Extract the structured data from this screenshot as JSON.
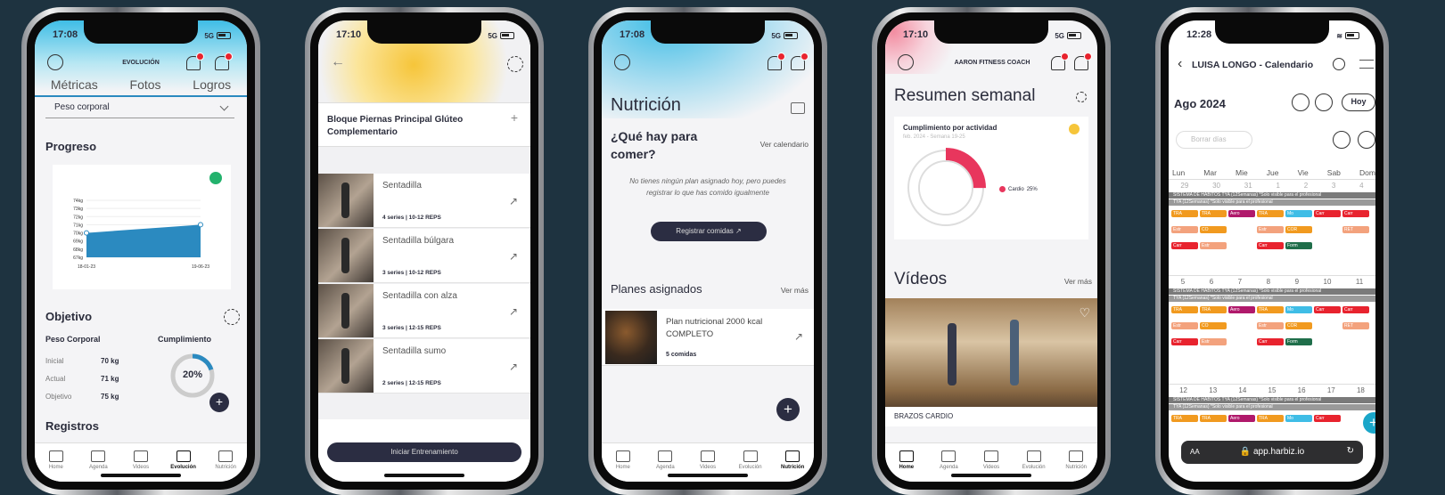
{
  "colors": {
    "bg": "#1e3340",
    "navy": "#2b2d42",
    "accent_pink": "#e8365d",
    "green": "#23b26d",
    "blue": "#2b8ac0"
  },
  "tabbar": [
    "Home",
    "Agenda",
    "Videos",
    "Evolución",
    "Nutrición"
  ],
  "p1": {
    "time": "17:08",
    "net": "5G",
    "title": "EVOLUCIÓN",
    "tabs": [
      "Métricas",
      "Fotos",
      "Logros"
    ],
    "select": "Peso corporal",
    "progress_title": "Progreso",
    "chart_data": {
      "type": "area",
      "x": [
        "18-01-23",
        "19-06-23"
      ],
      "y": [
        70,
        71
      ],
      "ylabels": [
        "74kg",
        "73kg",
        "72kg",
        "71kg",
        "70kg",
        "69kg",
        "68kg",
        "67kg"
      ],
      "ylim": [
        67,
        74
      ]
    },
    "goal_title": "Objetivo",
    "goal_label": "Peso Corporal",
    "compliance": "Cumplimiento",
    "rows": [
      {
        "k": "Inicial",
        "v": "70 kg"
      },
      {
        "k": "Actual",
        "v": "71 kg"
      },
      {
        "k": "Objetivo",
        "v": "75 kg"
      }
    ],
    "percent": "20%",
    "percent_value": 20,
    "records": "Registros"
  },
  "p2": {
    "time": "17:10",
    "net": "5G",
    "block": "Bloque Piernas Principal Glúteo Complementario",
    "exercises": [
      {
        "name": "Sentadilla",
        "meta": "4 series | 10-12 REPS"
      },
      {
        "name": "Sentadilla búlgara",
        "meta": "3 series | 10-12 REPS"
      },
      {
        "name": "Sentadilla con alza",
        "meta": "3 series | 12-15 REPS"
      },
      {
        "name": "Sentadilla sumo",
        "meta": "2 series | 12-15 REPS"
      }
    ],
    "start": "Iniciar Entrenamiento"
  },
  "p3": {
    "time": "17:08",
    "net": "5G",
    "title": "Nutrición",
    "q": "¿Qué hay para comer?",
    "cal": "Ver calendario",
    "empty": "No tienes ningún plan asignado hoy, pero puedes registrar lo que has comido igualmente",
    "register": "Registrar comidas",
    "plans": "Planes asignados",
    "more": "Ver más",
    "plan_name": "Plan nutricional 2000 kcal COMPLETO",
    "plan_meta": "5 comidas"
  },
  "p4": {
    "time": "17:10",
    "net": "5G",
    "coach": "AARON FITNESS COACH",
    "title": "Resumen semanal",
    "card_title": "Cumplimiento por actividad",
    "card_sub": "feb. 2024 - Semana 19-25",
    "legend": "Cardio",
    "legend_val": "25%",
    "donut_value": 25,
    "videos": "Vídeos",
    "more": "Ver más",
    "video_title": "BRAZOS CARDIO"
  },
  "p5": {
    "time": "12:28",
    "title": "LUISA LONGO - Calendario",
    "month": "Ago 2024",
    "today": "Hoy",
    "delete": "Borrar días",
    "days": [
      "Lun",
      "Mar",
      "Mie",
      "Jue",
      "Vie",
      "Sab",
      "Dom"
    ],
    "week1": [
      "29",
      "30",
      "31",
      "1",
      "2",
      "3",
      "4"
    ],
    "week2": [
      "5",
      "6",
      "7",
      "8",
      "9",
      "10",
      "11"
    ],
    "week3": [
      "12",
      "13",
      "14",
      "15",
      "16",
      "17",
      "18"
    ],
    "bar1": "SISTEMA DE HÁBITOS TYA (12Semanas) *Solo visible para el profesional",
    "bar2": "TYA (12Semanas) *Solo visible para el profesional",
    "events": [
      "TRA",
      "Estr",
      "Carr",
      "TRA",
      "CO",
      "Estr",
      "Carr",
      "Aero",
      "Mo",
      "TRA",
      "COR",
      "Estr",
      "Form",
      "Carr",
      "RET"
    ],
    "url": "app.harbiz.io",
    "aa": "AA"
  }
}
